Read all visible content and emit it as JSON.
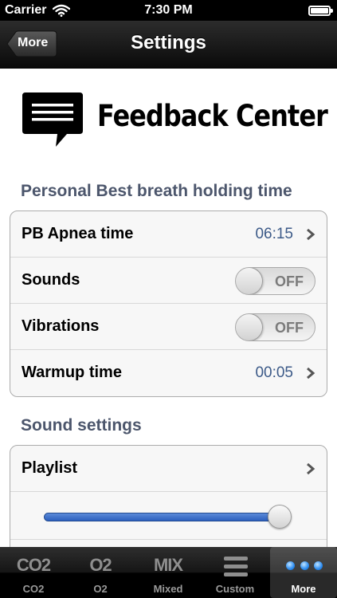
{
  "status_bar": {
    "carrier": "Carrier",
    "time": "7:30 PM"
  },
  "nav": {
    "back_label": "More",
    "title": "Settings"
  },
  "banner": {
    "text": "Feedback Center"
  },
  "sections": {
    "personal_best": {
      "header": "Personal Best breath holding time",
      "pb_apnea": {
        "label": "PB Apnea time",
        "value": "06:15"
      },
      "sounds": {
        "label": "Sounds",
        "state": "OFF"
      },
      "vibrations": {
        "label": "Vibrations",
        "state": "OFF"
      },
      "warmup": {
        "label": "Warmup time",
        "value": "00:05"
      }
    },
    "sound_settings": {
      "header": "Sound settings",
      "playlist": {
        "label": "Playlist"
      },
      "volume_level": 1.0
    }
  },
  "tabs": [
    {
      "icon_text": "CO2",
      "label": "CO2",
      "icon": "co2-icon"
    },
    {
      "icon_text": "O2",
      "label": "O2",
      "icon": "o2-icon"
    },
    {
      "icon_text": "MIX",
      "label": "Mixed",
      "icon": "mix-icon"
    },
    {
      "icon_text": "",
      "label": "Custom",
      "icon": "list-icon"
    },
    {
      "icon_text": "",
      "label": "More",
      "icon": "more-dots-icon",
      "active": true
    }
  ],
  "colors": {
    "value_text": "#3c5a88",
    "section_header": "#4c566c",
    "slider_fill": "#2b5fbd"
  }
}
